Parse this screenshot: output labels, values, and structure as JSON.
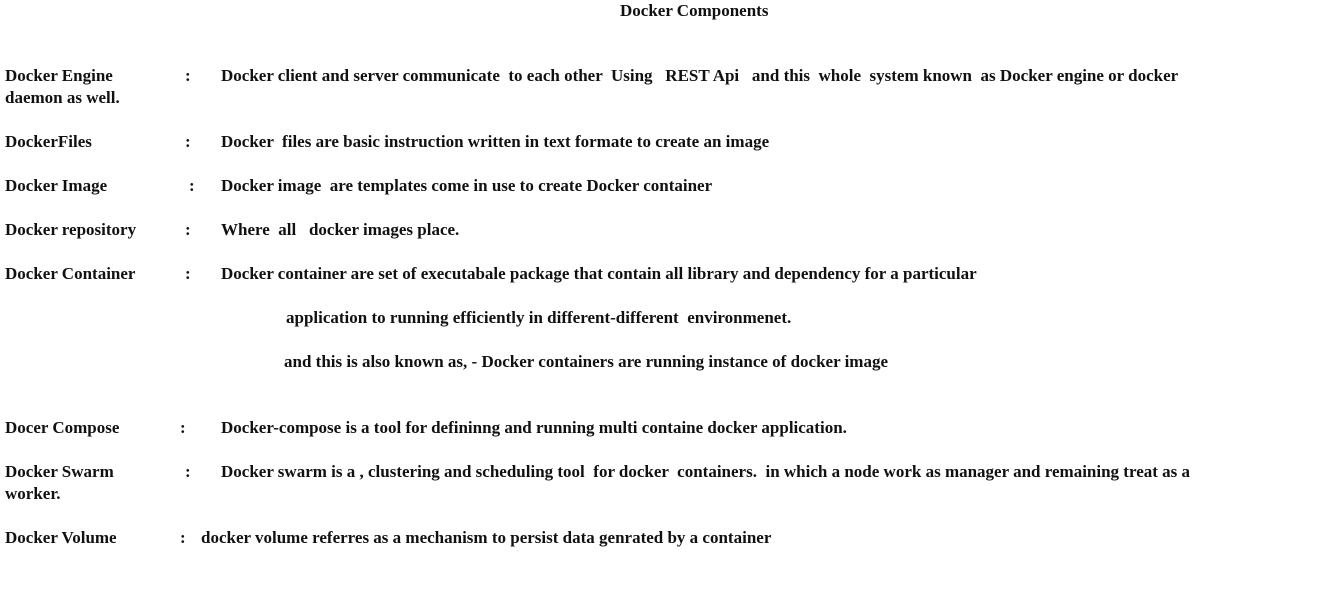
{
  "document": {
    "title": "Docker Components",
    "entries": [
      {
        "term": "Docker Engine",
        "colon": ":",
        "description": "Docker client and server communicate  to each other  Using   REST Api   and this  whole  system known  as Docker engine or docker",
        "continuation": "daemon as well."
      },
      {
        "term": "DockerFiles",
        "colon": ":",
        "description": "Docker  files are basic instruction written in text formate to create an image"
      },
      {
        "term": "Docker Image",
        "colon": ":",
        "description": "Docker image  are templates come in use to create Docker container"
      },
      {
        "term": "Docker repository",
        "colon": ":",
        "description": "Where  all   docker images place."
      },
      {
        "term": "Docker Container",
        "colon": ":",
        "description": "Docker container are set of executabale package that contain all library and dependency for a particular",
        "line2": "application to running efficiently in different-different  environmenet.",
        "line3": "and this is also known as, - Docker containers are running instance of docker image"
      },
      {
        "term": "Docer Compose",
        "colon": ":",
        "description": "Docker-compose is a tool for defininng and running multi containe docker application."
      },
      {
        "term": "Docker Swarm",
        "colon": ":",
        "description": "Docker swarm is a , clustering and scheduling tool  for docker  containers.  in which a node work as manager and remaining treat as a",
        "continuation": "worker."
      },
      {
        "term": "Docker Volume",
        "colon": ":",
        "description": "docker volume referres as a mechanism to persist data genrated by a container"
      }
    ]
  }
}
